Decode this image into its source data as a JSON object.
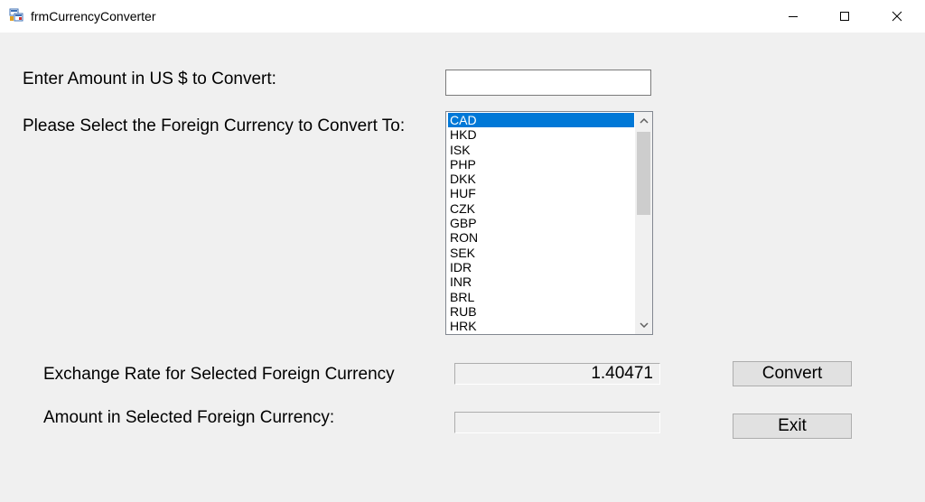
{
  "window": {
    "title": "frmCurrencyConverter"
  },
  "form": {
    "amount_label": "Enter Amount in US $ to Convert:",
    "amount_value": "",
    "currency_label": "Please Select the Foreign Currency to Convert To:",
    "currencies": [
      "CAD",
      "HKD",
      "ISK",
      "PHP",
      "DKK",
      "HUF",
      "CZK",
      "GBP",
      "RON",
      "SEK",
      "IDR",
      "INR",
      "BRL",
      "RUB",
      "HRK"
    ],
    "selected_currency": "CAD",
    "rate_label": "Exchange Rate for Selected Foreign Currency",
    "rate_value": "1.40471",
    "result_label": "Amount in Selected Foreign Currency:",
    "result_value": "",
    "convert_label": "Convert",
    "exit_label": "Exit"
  },
  "colors": {
    "selection": "#0078d7",
    "background": "#f0f0f0"
  }
}
